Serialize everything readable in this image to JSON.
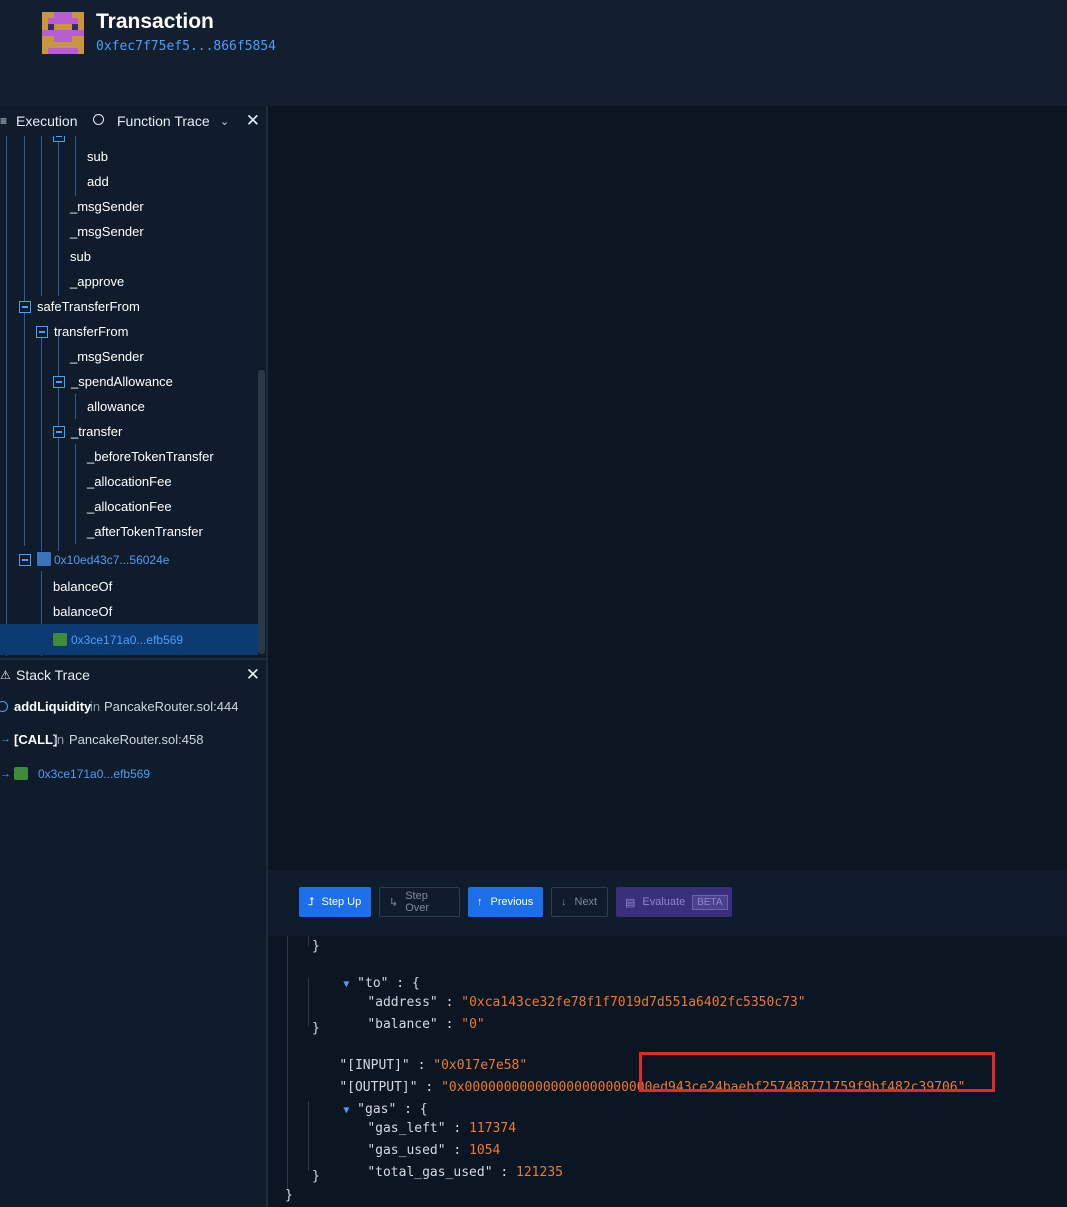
{
  "header": {
    "title": "Transaction",
    "address": "0xfec7f75ef5...866f5854"
  },
  "tabs": {
    "execution": "Execution",
    "function_trace": "Function Trace",
    "close": "✕"
  },
  "tree": [
    {
      "label": "sub"
    },
    {
      "label": "add"
    },
    {
      "label": "_msgSender"
    },
    {
      "label": "_msgSender"
    },
    {
      "label": "sub"
    },
    {
      "label": "_approve"
    },
    {
      "label": "safeTransferFrom"
    },
    {
      "label": "transferFrom"
    },
    {
      "label": "_msgSender"
    },
    {
      "label": "_spendAllowance"
    },
    {
      "label": "allowance"
    },
    {
      "label": "_transfer"
    },
    {
      "label": "_beforeTokenTransfer"
    },
    {
      "label": "_allocationFee"
    },
    {
      "label": "_allocationFee"
    },
    {
      "label": "_afterTokenTransfer"
    },
    {
      "label": "0x10ed43c7...56024e"
    },
    {
      "label": "balanceOf"
    },
    {
      "label": "balanceOf"
    },
    {
      "label": "0x3ce171a0...efb569"
    }
  ],
  "stack_trace": {
    "title": "Stack Trace",
    "close": "✕",
    "rows": [
      {
        "fn": "addLiquidity",
        "in": "in",
        "loc": "PancakeRouter.sol:444"
      },
      {
        "fn": "[CALL]",
        "in": "in",
        "loc": "PancakeRouter.sol:458"
      },
      {
        "fn": "0x3ce171a0...efb569"
      }
    ]
  },
  "toolbar": {
    "step_up": "Step Up",
    "step_over": "Step Over",
    "previous": "Previous",
    "next": "Next",
    "evaluate": "Evaluate",
    "beta": "BETA"
  },
  "json_view": {
    "close_brace": "}",
    "to_key": "\"to\"",
    "address_key": "\"address\"",
    "address_val": "\"0xca143ce32fe78f1f7019d7d551a6402fc5350c73\"",
    "balance_key": "\"balance\"",
    "balance_val": "\"0\"",
    "input_key": "\"[INPUT]\"",
    "input_val": "\"0x017e7e58\"",
    "output_key": "\"[OUTPUT]\"",
    "output_val": "\"0x000000000000000000000000ed943ce24baebf257488771759f9bf482c39706\"",
    "gas_key": "\"gas\"",
    "gas_left_key": "\"gas_left\"",
    "gas_left_val": "117374",
    "gas_used_key": "\"gas_used\"",
    "gas_used_val": "1054",
    "total_gas_used_key": "\"total_gas_used\"",
    "total_gas_used_val": "121235"
  },
  "colors": {
    "accent": "#1c6fe8",
    "string": "#e87a3a",
    "highlight": "#e02b2b"
  }
}
